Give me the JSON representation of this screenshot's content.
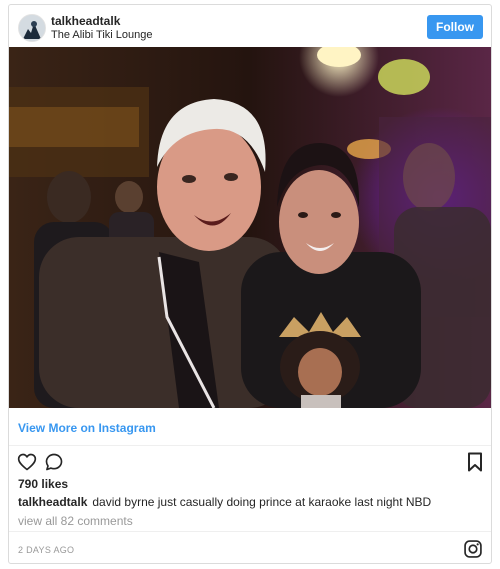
{
  "header": {
    "username": "talkheadtalk",
    "location": "The Alibi Tiki Lounge",
    "follow_label": "Follow"
  },
  "post": {
    "view_more_label": "View More on Instagram",
    "likes": "790 likes",
    "caption_user": "talkheadtalk",
    "caption_text": "david byrne just casually doing prince at karaoke last night NBD",
    "comments_link": "view all 82 comments",
    "timestamp": "2 DAYS AGO"
  },
  "icons": {
    "like": "heart-icon",
    "comment": "comment-icon",
    "save": "bookmark-icon",
    "logo": "instagram-logo-icon"
  },
  "colors": {
    "accent": "#3897f0",
    "text": "#262626",
    "muted": "#999999",
    "border": "#dbdbdb"
  }
}
